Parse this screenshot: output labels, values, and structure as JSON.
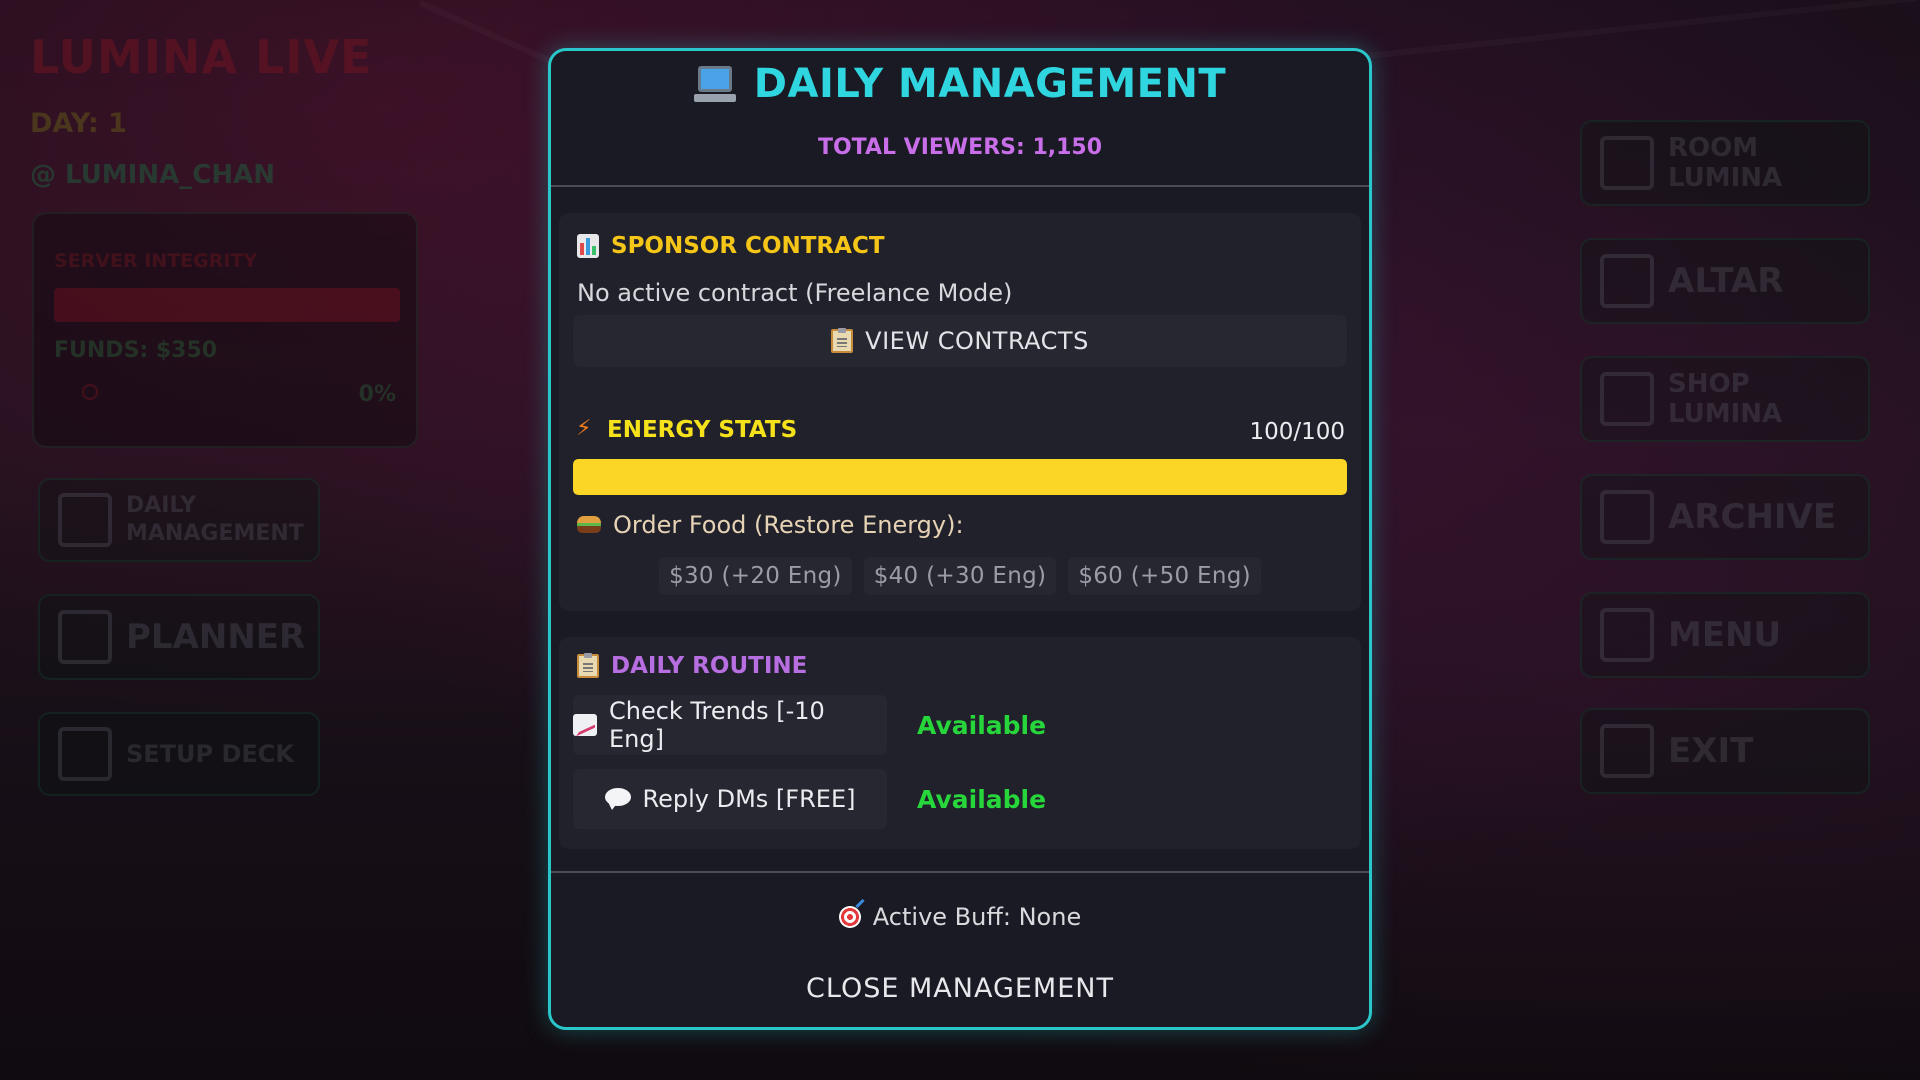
{
  "background": {
    "game_title": "LUMINA LIVE",
    "day": "DAY: 1",
    "handle": "@ LUMINA_CHAN",
    "status": {
      "server_integrity_label": "SERVER INTEGRITY",
      "funds": "FUNDS: $350",
      "percent": "0%"
    },
    "left_menu": [
      {
        "label": "DAILY\nMANAGEMENT",
        "icon": "clipboard-icon"
      },
      {
        "label": "PLANNER",
        "icon": "calendar-grid-icon"
      },
      {
        "label": "SETUP DECK",
        "icon": "deck-card-icon"
      }
    ],
    "right_menu": [
      {
        "label": "ROOM\nLUMINA",
        "icon": "house-icon"
      },
      {
        "label": "ALTAR",
        "icon": "gear-icon"
      },
      {
        "label": "SHOP\nLUMINA",
        "icon": "cart-icon"
      },
      {
        "label": "ARCHIVE",
        "icon": "book-icon"
      },
      {
        "label": "MENU",
        "icon": "menu-list-icon"
      },
      {
        "label": "EXIT",
        "icon": "exit-door-icon"
      }
    ]
  },
  "modal": {
    "title": "DAILY MANAGEMENT",
    "title_icon": "laptop-icon",
    "total_viewers": "TOTAL VIEWERS: 1,150",
    "sponsor": {
      "title": "SPONSOR CONTRACT",
      "icon": "chart-icon",
      "status": "No active contract (Freelance Mode)",
      "button_label": "VIEW CONTRACTS",
      "button_icon": "clipboard-icon"
    },
    "energy": {
      "title": "ENERGY STATS",
      "icon": "lightning-icon",
      "value_text": "100/100",
      "level": 1.0,
      "food_label": "Order Food (Restore Energy):",
      "food_icon": "burger-icon",
      "food_options": [
        "$30 (+20 Eng)",
        "$40 (+30 Eng)",
        "$60 (+50 Eng)"
      ]
    },
    "routine": {
      "title": "DAILY ROUTINE",
      "icon": "clipboard-icon",
      "tasks": [
        {
          "label": "Check Trends [-10 Eng]",
          "icon": "trend-chart-icon",
          "status": "Available"
        },
        {
          "label": "Reply DMs [FREE]",
          "icon": "speech-bubble-icon",
          "status": "Available"
        }
      ]
    },
    "active_buff": "Active Buff: None",
    "buff_icon": "target-icon",
    "close_label": "CLOSE MANAGEMENT"
  },
  "colors": {
    "modal_border": "#29c7c9",
    "title": "#2fd6e0",
    "viewers": "#c86ee8",
    "sponsor_title": "#f5c518",
    "energy_title": "#f5e21a",
    "routine_title": "#b76ee0",
    "energy_fill": "#fcd626",
    "available": "#27d63a"
  }
}
